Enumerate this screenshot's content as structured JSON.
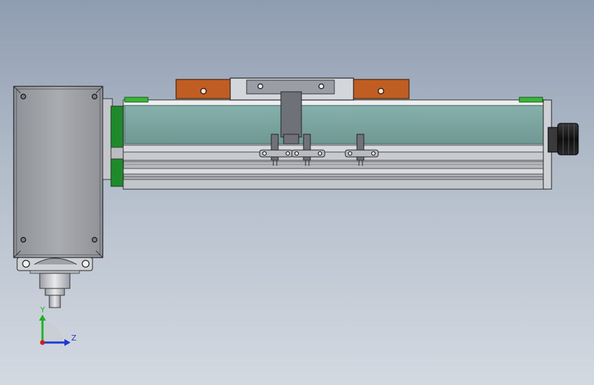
{
  "viewport": {
    "type": "cad-3d-view",
    "background_top": "#8f9db1",
    "background_bottom": "#d3d9e1"
  },
  "triad": {
    "y_label": "Y",
    "z_label": "Z",
    "y_color": "#18b51f",
    "z_color": "#1c37d6",
    "origin_color": "#d51b1b"
  },
  "model": {
    "name": "linear-actuator",
    "parts": [
      "motor-housing",
      "motor-flange",
      "motor-shaft",
      "coupling-block",
      "actuator-body",
      "guide-cover",
      "carriage-block",
      "mounting-plate",
      "sensor-brackets",
      "cable-connector",
      "end-caps"
    ],
    "colors": {
      "body": "#c9cdd3",
      "cover": "#7ba7a2",
      "carriage_wood": "#bf5d22",
      "coupling": "#1f8a2b",
      "end_cap": "#3cb43c",
      "connector": "#1e1e1e",
      "motor": "#a6a9ad"
    }
  }
}
